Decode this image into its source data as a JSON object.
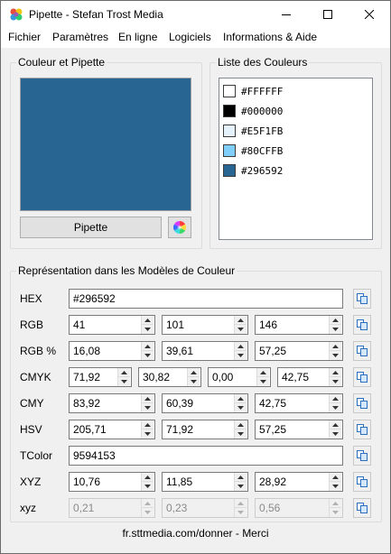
{
  "window": {
    "title": "Pipette - Stefan Trost Media"
  },
  "menu": [
    "Fichier",
    "Paramètres",
    "En ligne",
    "Logiciels",
    "Informations & Aide"
  ],
  "pipette_group": {
    "title": "Couleur et Pipette",
    "button_label": "Pipette",
    "current_color": "#296592"
  },
  "list_group": {
    "title": "Liste des Couleurs",
    "colors": [
      {
        "hex": "#FFFFFF"
      },
      {
        "hex": "#000000"
      },
      {
        "hex": "#E5F1FB"
      },
      {
        "hex": "#80CFFB"
      },
      {
        "hex": "#296592"
      }
    ]
  },
  "models_group": {
    "title": "Représentation dans les Modèles de Couleur",
    "rows": [
      {
        "label": "HEX",
        "values": [
          "#296592"
        ]
      },
      {
        "label": "RGB",
        "values": [
          "41",
          "101",
          "146"
        ]
      },
      {
        "label": "RGB %",
        "values": [
          "16,08",
          "39,61",
          "57,25"
        ]
      },
      {
        "label": "CMYK",
        "values": [
          "71,92",
          "30,82",
          "0,00",
          "42,75"
        ]
      },
      {
        "label": "CMY",
        "values": [
          "83,92",
          "60,39",
          "42,75"
        ]
      },
      {
        "label": "HSV",
        "values": [
          "205,71",
          "71,92",
          "57,25"
        ]
      },
      {
        "label": "TColor",
        "values": [
          "9594153"
        ]
      },
      {
        "label": "XYZ",
        "values": [
          "10,76",
          "11,85",
          "28,92"
        ]
      },
      {
        "label": "xyz",
        "values": [
          "0,21",
          "0,23",
          "0,56"
        ]
      }
    ]
  },
  "footer": {
    "text": "fr.sttmedia.com/donner - Merci"
  }
}
